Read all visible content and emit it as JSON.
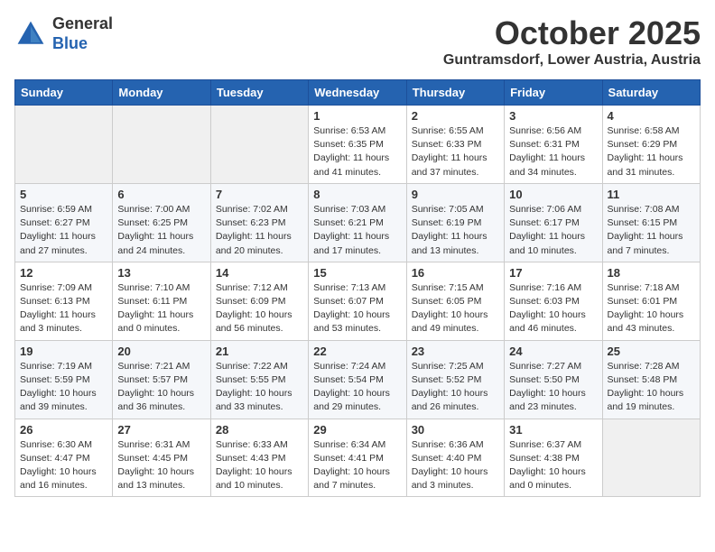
{
  "logo": {
    "general": "General",
    "blue": "Blue"
  },
  "title": "October 2025",
  "location": "Guntramsdorf, Lower Austria, Austria",
  "weekdays": [
    "Sunday",
    "Monday",
    "Tuesday",
    "Wednesday",
    "Thursday",
    "Friday",
    "Saturday"
  ],
  "weeks": [
    [
      {
        "day": "",
        "info": ""
      },
      {
        "day": "",
        "info": ""
      },
      {
        "day": "",
        "info": ""
      },
      {
        "day": "1",
        "info": "Sunrise: 6:53 AM\nSunset: 6:35 PM\nDaylight: 11 hours\nand 41 minutes."
      },
      {
        "day": "2",
        "info": "Sunrise: 6:55 AM\nSunset: 6:33 PM\nDaylight: 11 hours\nand 37 minutes."
      },
      {
        "day": "3",
        "info": "Sunrise: 6:56 AM\nSunset: 6:31 PM\nDaylight: 11 hours\nand 34 minutes."
      },
      {
        "day": "4",
        "info": "Sunrise: 6:58 AM\nSunset: 6:29 PM\nDaylight: 11 hours\nand 31 minutes."
      }
    ],
    [
      {
        "day": "5",
        "info": "Sunrise: 6:59 AM\nSunset: 6:27 PM\nDaylight: 11 hours\nand 27 minutes."
      },
      {
        "day": "6",
        "info": "Sunrise: 7:00 AM\nSunset: 6:25 PM\nDaylight: 11 hours\nand 24 minutes."
      },
      {
        "day": "7",
        "info": "Sunrise: 7:02 AM\nSunset: 6:23 PM\nDaylight: 11 hours\nand 20 minutes."
      },
      {
        "day": "8",
        "info": "Sunrise: 7:03 AM\nSunset: 6:21 PM\nDaylight: 11 hours\nand 17 minutes."
      },
      {
        "day": "9",
        "info": "Sunrise: 7:05 AM\nSunset: 6:19 PM\nDaylight: 11 hours\nand 13 minutes."
      },
      {
        "day": "10",
        "info": "Sunrise: 7:06 AM\nSunset: 6:17 PM\nDaylight: 11 hours\nand 10 minutes."
      },
      {
        "day": "11",
        "info": "Sunrise: 7:08 AM\nSunset: 6:15 PM\nDaylight: 11 hours\nand 7 minutes."
      }
    ],
    [
      {
        "day": "12",
        "info": "Sunrise: 7:09 AM\nSunset: 6:13 PM\nDaylight: 11 hours\nand 3 minutes."
      },
      {
        "day": "13",
        "info": "Sunrise: 7:10 AM\nSunset: 6:11 PM\nDaylight: 11 hours\nand 0 minutes."
      },
      {
        "day": "14",
        "info": "Sunrise: 7:12 AM\nSunset: 6:09 PM\nDaylight: 10 hours\nand 56 minutes."
      },
      {
        "day": "15",
        "info": "Sunrise: 7:13 AM\nSunset: 6:07 PM\nDaylight: 10 hours\nand 53 minutes."
      },
      {
        "day": "16",
        "info": "Sunrise: 7:15 AM\nSunset: 6:05 PM\nDaylight: 10 hours\nand 49 minutes."
      },
      {
        "day": "17",
        "info": "Sunrise: 7:16 AM\nSunset: 6:03 PM\nDaylight: 10 hours\nand 46 minutes."
      },
      {
        "day": "18",
        "info": "Sunrise: 7:18 AM\nSunset: 6:01 PM\nDaylight: 10 hours\nand 43 minutes."
      }
    ],
    [
      {
        "day": "19",
        "info": "Sunrise: 7:19 AM\nSunset: 5:59 PM\nDaylight: 10 hours\nand 39 minutes."
      },
      {
        "day": "20",
        "info": "Sunrise: 7:21 AM\nSunset: 5:57 PM\nDaylight: 10 hours\nand 36 minutes."
      },
      {
        "day": "21",
        "info": "Sunrise: 7:22 AM\nSunset: 5:55 PM\nDaylight: 10 hours\nand 33 minutes."
      },
      {
        "day": "22",
        "info": "Sunrise: 7:24 AM\nSunset: 5:54 PM\nDaylight: 10 hours\nand 29 minutes."
      },
      {
        "day": "23",
        "info": "Sunrise: 7:25 AM\nSunset: 5:52 PM\nDaylight: 10 hours\nand 26 minutes."
      },
      {
        "day": "24",
        "info": "Sunrise: 7:27 AM\nSunset: 5:50 PM\nDaylight: 10 hours\nand 23 minutes."
      },
      {
        "day": "25",
        "info": "Sunrise: 7:28 AM\nSunset: 5:48 PM\nDaylight: 10 hours\nand 19 minutes."
      }
    ],
    [
      {
        "day": "26",
        "info": "Sunrise: 6:30 AM\nSunset: 4:47 PM\nDaylight: 10 hours\nand 16 minutes."
      },
      {
        "day": "27",
        "info": "Sunrise: 6:31 AM\nSunset: 4:45 PM\nDaylight: 10 hours\nand 13 minutes."
      },
      {
        "day": "28",
        "info": "Sunrise: 6:33 AM\nSunset: 4:43 PM\nDaylight: 10 hours\nand 10 minutes."
      },
      {
        "day": "29",
        "info": "Sunrise: 6:34 AM\nSunset: 4:41 PM\nDaylight: 10 hours\nand 7 minutes."
      },
      {
        "day": "30",
        "info": "Sunrise: 6:36 AM\nSunset: 4:40 PM\nDaylight: 10 hours\nand 3 minutes."
      },
      {
        "day": "31",
        "info": "Sunrise: 6:37 AM\nSunset: 4:38 PM\nDaylight: 10 hours\nand 0 minutes."
      },
      {
        "day": "",
        "info": ""
      }
    ]
  ]
}
